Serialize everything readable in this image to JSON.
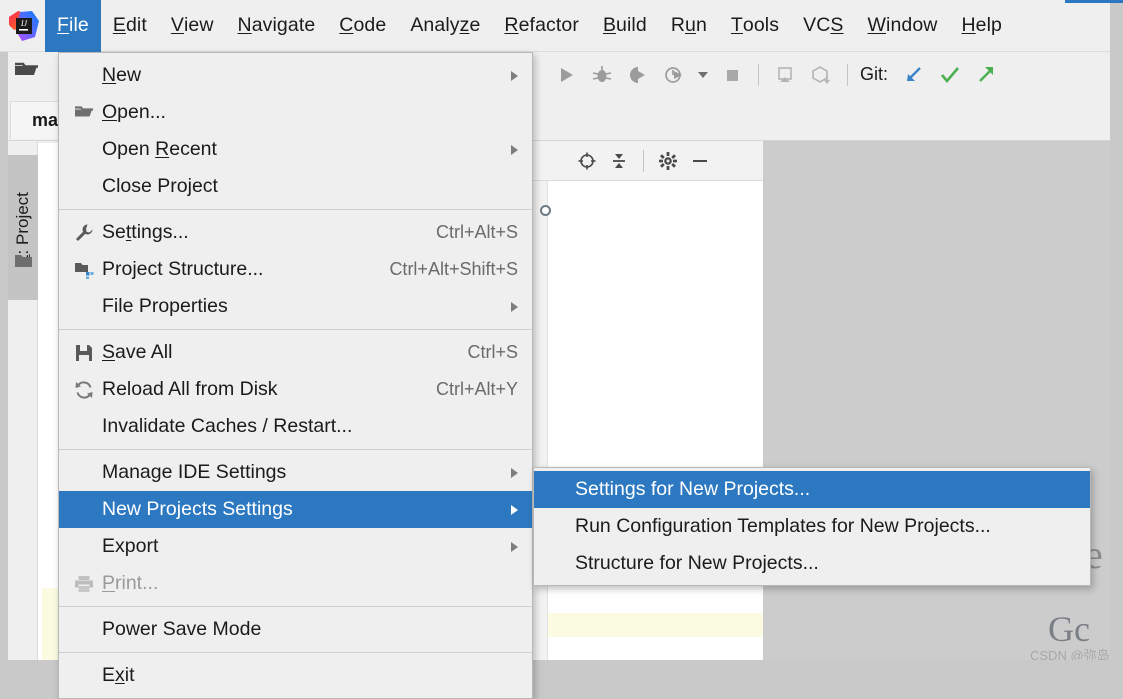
{
  "app": {
    "name": "IntelliJ IDEA",
    "logo_icon": "intellij-idea-logo"
  },
  "menubar": {
    "items": [
      {
        "label": "File",
        "mnemonic": "F",
        "active": true
      },
      {
        "label": "Edit",
        "mnemonic": "E",
        "active": false
      },
      {
        "label": "View",
        "mnemonic": "V",
        "active": false
      },
      {
        "label": "Navigate",
        "mnemonic": "N",
        "active": false
      },
      {
        "label": "Code",
        "mnemonic": "C",
        "active": false
      },
      {
        "label": "Analyze",
        "mnemonic": "z",
        "active": false
      },
      {
        "label": "Refactor",
        "mnemonic": "R",
        "active": false
      },
      {
        "label": "Build",
        "mnemonic": "B",
        "active": false
      },
      {
        "label": "Run",
        "mnemonic": "n",
        "active": false
      },
      {
        "label": "Tools",
        "mnemonic": "T",
        "active": false
      },
      {
        "label": "VCS",
        "mnemonic": "S",
        "active": false
      },
      {
        "label": "Window",
        "mnemonic": "W",
        "active": false
      },
      {
        "label": "Help",
        "mnemonic": "H",
        "active": false
      }
    ]
  },
  "toolbar": {
    "icons": [
      "run-icon",
      "debug-icon",
      "run-with-coverage-icon",
      "profile-icon",
      "dropdown-caret-icon",
      "stop-icon",
      "attach-debugger-icon",
      "build-artifacts-icon"
    ],
    "git_label": "Git:",
    "git_icons": [
      "update-project-icon",
      "commit-checkmark-icon",
      "push-arrow-icon"
    ]
  },
  "tool_window_strip": {
    "icons": [
      "locate-icon",
      "collapse-all-icon",
      "settings-gear-icon",
      "hide-minus-icon"
    ]
  },
  "left_stripe": {
    "tab_label": "1: Project",
    "tab_mnemonic": "1",
    "folder_icon": "folder-icon"
  },
  "editor_tab": {
    "label": "ma"
  },
  "file_menu": {
    "groups": [
      [
        {
          "label": "New",
          "mnemonic": "N",
          "icon": null,
          "shortcut": null,
          "submenu": true,
          "disabled": false,
          "selected": false
        },
        {
          "label": "Open...",
          "mnemonic": "O",
          "icon": "folder-open-icon",
          "shortcut": null,
          "submenu": false,
          "disabled": false,
          "selected": false
        },
        {
          "label": "Open Recent",
          "mnemonic": "R",
          "icon": null,
          "shortcut": null,
          "submenu": true,
          "disabled": false,
          "selected": false
        },
        {
          "label": "Close Project",
          "mnemonic": null,
          "icon": null,
          "shortcut": null,
          "submenu": false,
          "disabled": false,
          "selected": false
        }
      ],
      [
        {
          "label": "Settings...",
          "mnemonic": "t",
          "icon": "wrench-icon",
          "shortcut": "Ctrl+Alt+S",
          "submenu": false,
          "disabled": false,
          "selected": false
        },
        {
          "label": "Project Structure...",
          "mnemonic": null,
          "icon": "project-structure-icon",
          "shortcut": "Ctrl+Alt+Shift+S",
          "submenu": false,
          "disabled": false,
          "selected": false
        },
        {
          "label": "File Properties",
          "mnemonic": null,
          "icon": null,
          "shortcut": null,
          "submenu": true,
          "disabled": false,
          "selected": false
        }
      ],
      [
        {
          "label": "Save All",
          "mnemonic": "S",
          "icon": "save-floppy-icon",
          "shortcut": "Ctrl+S",
          "submenu": false,
          "disabled": false,
          "selected": false
        },
        {
          "label": "Reload All from Disk",
          "mnemonic": null,
          "icon": "reload-icon",
          "shortcut": "Ctrl+Alt+Y",
          "submenu": false,
          "disabled": false,
          "selected": false
        },
        {
          "label": "Invalidate Caches / Restart...",
          "mnemonic": null,
          "icon": null,
          "shortcut": null,
          "submenu": false,
          "disabled": false,
          "selected": false
        }
      ],
      [
        {
          "label": "Manage IDE Settings",
          "mnemonic": null,
          "icon": null,
          "shortcut": null,
          "submenu": true,
          "disabled": false,
          "selected": false
        },
        {
          "label": "New Projects Settings",
          "mnemonic": null,
          "icon": null,
          "shortcut": null,
          "submenu": true,
          "disabled": false,
          "selected": true
        },
        {
          "label": "Export",
          "mnemonic": null,
          "icon": null,
          "shortcut": null,
          "submenu": true,
          "disabled": false,
          "selected": false
        },
        {
          "label": "Print...",
          "mnemonic": "P",
          "icon": "printer-icon",
          "shortcut": null,
          "submenu": false,
          "disabled": true,
          "selected": false
        }
      ],
      [
        {
          "label": "Power Save Mode",
          "mnemonic": null,
          "icon": null,
          "shortcut": null,
          "submenu": false,
          "disabled": false,
          "selected": false
        }
      ],
      [
        {
          "label": "Exit",
          "mnemonic": "x",
          "icon": null,
          "shortcut": null,
          "submenu": false,
          "disabled": false,
          "selected": false
        }
      ]
    ]
  },
  "new_projects_submenu": {
    "items": [
      {
        "label": "Settings for New Projects...",
        "selected": true
      },
      {
        "label": "Run Configuration Templates for New Projects...",
        "selected": false
      },
      {
        "label": "Structure for New Projects...",
        "selected": false
      }
    ]
  },
  "watermarks": {
    "partial_letter": "e",
    "partial_word": "Gc",
    "credit": "CSDN @弥岛"
  },
  "colors": {
    "accent_blue": "#2d79c1",
    "menu_bg": "#efefef",
    "frame_grey": "#c9c9c9",
    "canvas_grey": "#cccccc",
    "highlight_yellow": "#fbfbe2",
    "git_update": "#3a85c8",
    "git_commit": "#4caf50",
    "git_push": "#4caf50"
  }
}
